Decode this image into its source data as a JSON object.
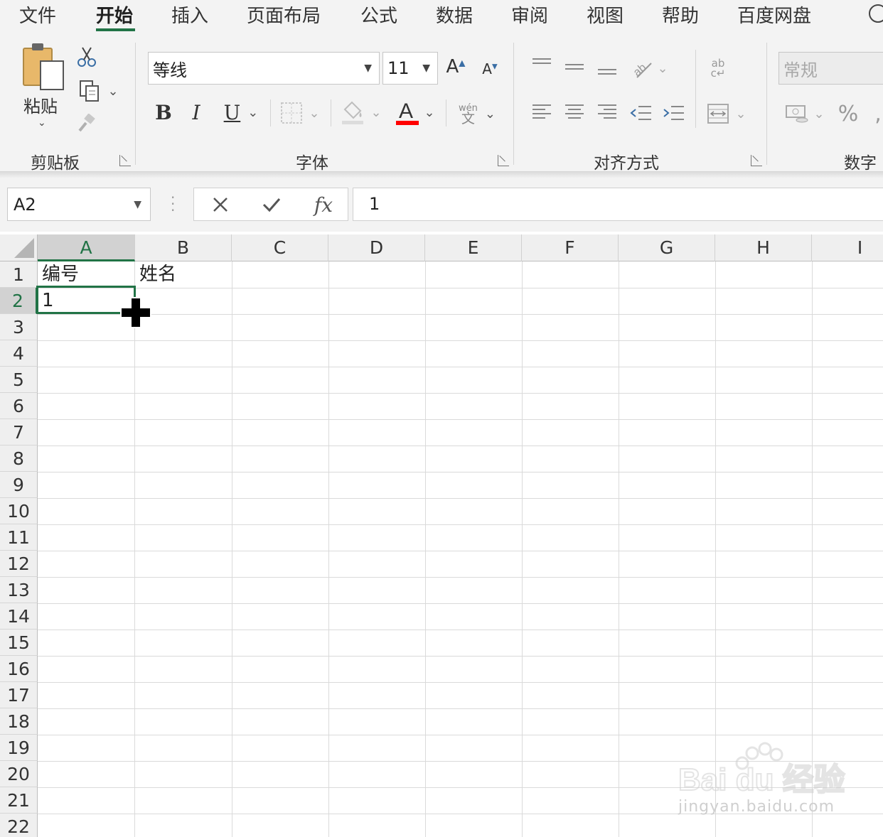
{
  "menu_tabs": [
    "文件",
    "开始",
    "插入",
    "页面布局",
    "公式",
    "数据",
    "审阅",
    "视图",
    "帮助",
    "百度网盘"
  ],
  "active_tab": "开始",
  "clipboard": {
    "paste_label": "粘贴",
    "group_label": "剪贴板"
  },
  "font": {
    "name": "等线",
    "size": "11",
    "group_label": "字体",
    "font_color": "#ff0000",
    "phonetic_top": "wén",
    "phonetic_bottom": "文"
  },
  "alignment": {
    "group_label": "对齐方式"
  },
  "number": {
    "format": "常规",
    "percent": "%",
    "group_label": "数字"
  },
  "formula_bar": {
    "name_box": "A2",
    "fx_label": "fx",
    "value": "1"
  },
  "columns": [
    "A",
    "B",
    "C",
    "D",
    "E",
    "F",
    "G",
    "H",
    "I"
  ],
  "rows": [
    "1",
    "2",
    "3",
    "4",
    "5",
    "6",
    "7",
    "8",
    "9",
    "10",
    "11",
    "12",
    "13",
    "14",
    "15",
    "16",
    "17",
    "18",
    "19",
    "20",
    "21",
    "22"
  ],
  "cells": {
    "A1": "编号",
    "B1": "姓名",
    "A2": "1"
  },
  "selected_cell": "A2",
  "accent_color": "#217346",
  "watermark": {
    "brand": "Bai du 经验",
    "url": "jingyan.baidu.com"
  }
}
